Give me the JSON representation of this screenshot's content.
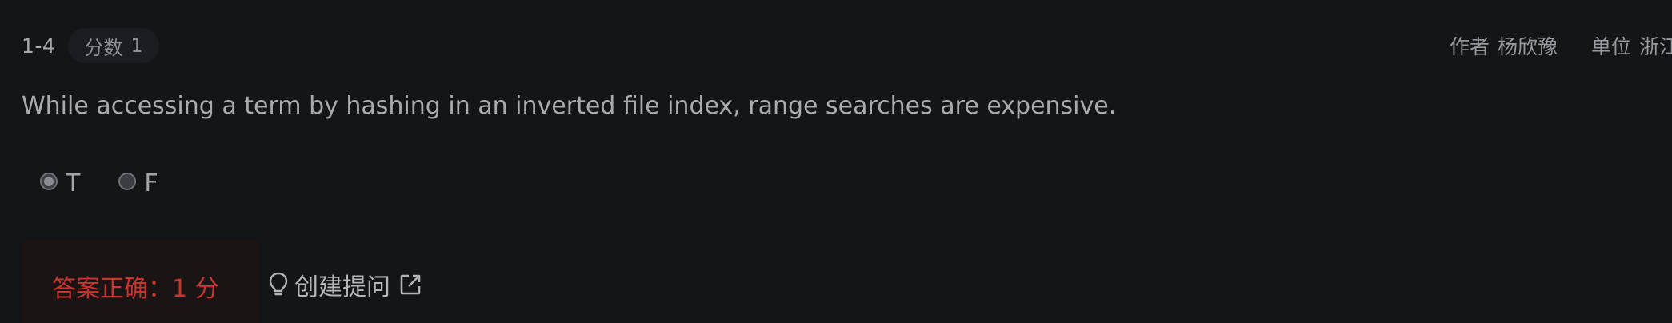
{
  "question": {
    "number": "1-4",
    "score_label": "分数",
    "score_value": "1",
    "text": "While accessing a term by hashing in an inverted file index, range searches are expensive."
  },
  "meta": {
    "author_label": "作者",
    "author_name": "杨欣豫",
    "unit_label": "单位",
    "unit_value": "浙江"
  },
  "options": [
    {
      "label": "T",
      "selected": true
    },
    {
      "label": "F",
      "selected": false
    }
  ],
  "result": {
    "text": "答案正确：1 分",
    "color": "#c9352e"
  },
  "ask": {
    "label": "创建提问",
    "icon": "lightbulb-icon",
    "trailing_icon": "external-link-icon"
  },
  "colors": {
    "background": "#141517",
    "result_bg": "#1a1414",
    "text": "#a9abaf"
  }
}
